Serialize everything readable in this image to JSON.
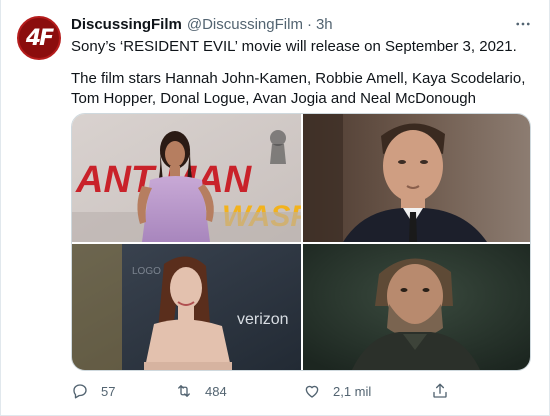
{
  "tweet": {
    "avatar_text": "4F",
    "display_name": "DiscussingFilm",
    "handle": "@DiscussingFilm",
    "separator": "·",
    "time": "3h",
    "more_label": "•••",
    "text_line1": "Sony’s ‘RESIDENT EVIL’ movie will release on September 3, 2021.",
    "text_line2": "The film stars Hannah John-Kamen, Robbie Amell, Kaya Scodelario, Tom Hopper, Donal Logue, Avan Jogia and Neal McDonough"
  },
  "media": {
    "photos": [
      {
        "subject": "actress-premiere",
        "backdrop_text": "ANT-MAN",
        "backdrop_sub": "WASP"
      },
      {
        "subject": "actor-portrait-suit"
      },
      {
        "subject": "actress-premiere-dark",
        "backdrop_text": "verizon"
      },
      {
        "subject": "actor-bearded-portrait"
      }
    ]
  },
  "actions": {
    "reply_count": "57",
    "retweet_count": "484",
    "like_count": "2,1 mil",
    "reply_icon": "reply-icon",
    "retweet_icon": "retweet-icon",
    "like_icon": "heart-icon",
    "share_icon": "share-icon"
  },
  "colors": {
    "text": "#0f1419",
    "secondary": "#536471",
    "border": "#cfd9de",
    "avatar_bg": "#8b0d0d"
  }
}
